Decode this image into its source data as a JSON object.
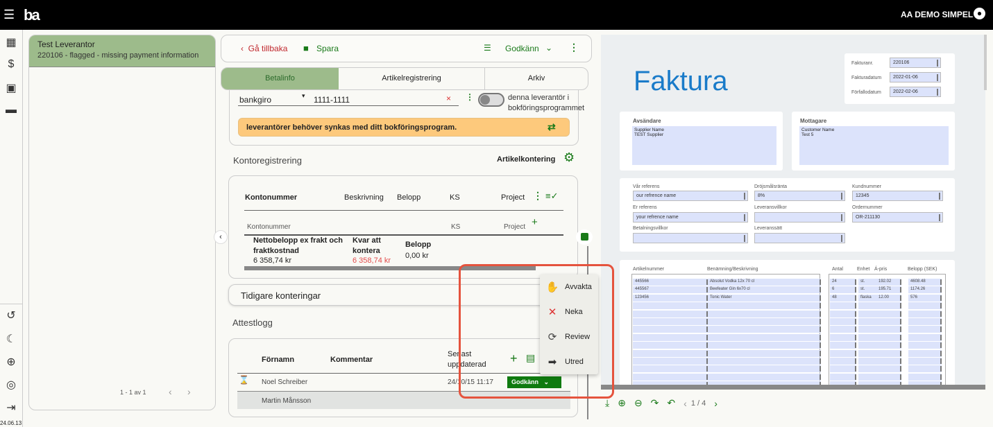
{
  "topbar": {
    "logo": "ba",
    "company": "AA DEMO SIMPEL"
  },
  "rail": {
    "version": "24.06.13"
  },
  "list": {
    "title": "Test Leverantor",
    "subtitle": "220106 - flagged - missing payment information",
    "pagination": "1 - 1 av 1"
  },
  "actions": {
    "back": "Gå tillbaka",
    "save": "Spara",
    "approve": "Godkänn"
  },
  "tabs": [
    "Betalinfo",
    "Artikelregistrering",
    "Arkiv"
  ],
  "payment": {
    "type": "bankgiro",
    "number": "1111-1111",
    "toggle_label": "denna leverantör i bokföringsprogrammet",
    "banner": "leverantörer behöver synkas med ditt bokföringsprogram."
  },
  "konto": {
    "title": "Kontoregistrering",
    "artikelkontering": "Artikelkontering",
    "headers": [
      "Kontonummer",
      "Beskrivning",
      "Belopp",
      "KS",
      "Project"
    ],
    "subheaders": [
      "Kontonummer",
      "KS",
      "Project"
    ],
    "netto_label": "Nettobelopp ex frakt och fraktkostnad",
    "netto_value": "6 358,74 kr",
    "kvar_label": "Kvar att kontera",
    "kvar_value": "6 358,74 kr",
    "belopp_label": "Belopp",
    "belopp_value": "0,00 kr"
  },
  "tidigare": "Tidigare konteringar",
  "attest": {
    "title": "Attestlogg",
    "headers": [
      "Förnamn",
      "Kommentar",
      "Senast uppdaterad"
    ],
    "rows": [
      {
        "name": "Noel Schreiber",
        "date": "24/10/15 11:17",
        "status": "Godkänn"
      },
      {
        "name": "Martin Månsson"
      }
    ]
  },
  "menu": [
    "Avvakta",
    "Neka",
    "Review",
    "Utred"
  ],
  "invoice": {
    "title": "Faktura",
    "meta": [
      {
        "label": "Fakturanr.",
        "value": "220106"
      },
      {
        "label": "Fakturadatum",
        "value": "2022-01-06"
      },
      {
        "label": "Förfallodatum",
        "value": "2022-02-06"
      }
    ],
    "sender_label": "Avsändare",
    "sender": [
      "Supplier Name",
      "TEST Supplier"
    ],
    "receiver_label": "Mottagare",
    "receiver": [
      "Customer Name",
      "Test 5"
    ],
    "fields": [
      {
        "label": "Vår referens",
        "value": "our refrence name"
      },
      {
        "label": "Dröjsmålsränta",
        "value": "8%"
      },
      {
        "label": "Kundnummer",
        "value": "12345"
      },
      {
        "label": "Er referens",
        "value": "your refrence name"
      },
      {
        "label": "Leveransvillkor",
        "value": ""
      },
      {
        "label": "Ordernummer",
        "value": "OR-211130"
      },
      {
        "label": "Betalningsvillkor",
        "value": ""
      },
      {
        "label": "Leveranssätt",
        "value": ""
      }
    ],
    "item_headers": [
      "Artikelnummer",
      "Benämning/Beskrivning",
      "Antal",
      "Enhet",
      "Á-pris",
      "Belopp (SEK)"
    ],
    "items": [
      [
        "445566",
        "Absolut Vodka 12x 70 cl",
        "24",
        "st.",
        "192.02",
        "4608.48"
      ],
      [
        "445567",
        "Beefeater Gin 6x70 cl",
        "6",
        "st.",
        "195.71",
        "1174.26"
      ],
      [
        "123456",
        "Tonic Water",
        "48",
        "flaska",
        "12.00",
        "576"
      ]
    ]
  },
  "viewer": {
    "page": "1 / 4"
  }
}
